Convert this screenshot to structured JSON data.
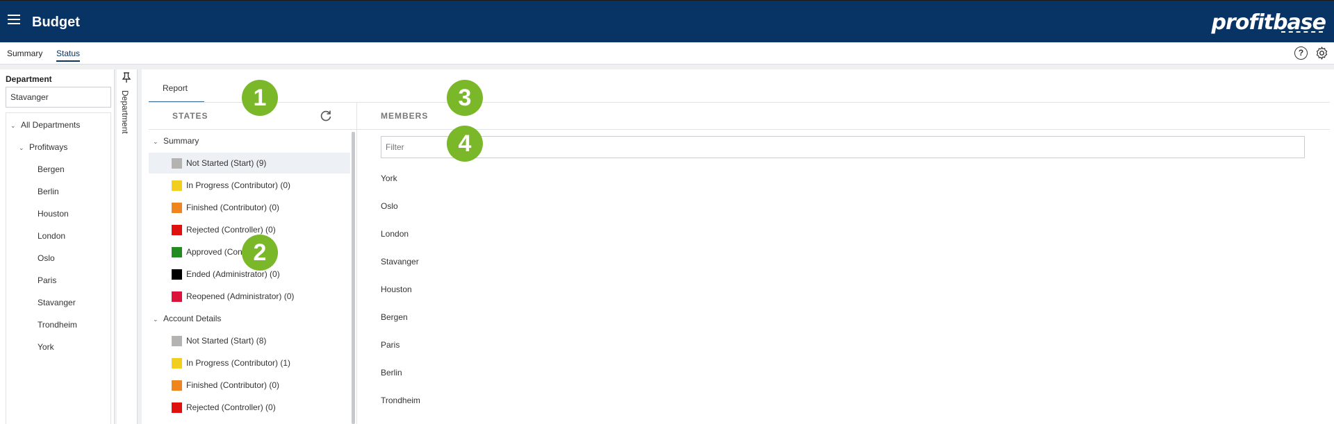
{
  "header": {
    "app_title": "Budget",
    "logo_text": "profitbase",
    "bg_color": "#073365"
  },
  "tabs": [
    {
      "label": "Summary",
      "active": false
    },
    {
      "label": "Status",
      "active": true
    }
  ],
  "toolbar_icons": {
    "help": "question-circle-icon",
    "settings": "gear-icon"
  },
  "department": {
    "label": "Department",
    "value": "Stavanger",
    "tree": [
      {
        "label": "All Departments",
        "level": 0,
        "expanded": true
      },
      {
        "label": "Profitways",
        "level": 1,
        "expanded": true
      },
      {
        "label": "Bergen",
        "level": 2
      },
      {
        "label": "Berlin",
        "level": 2
      },
      {
        "label": "Houston",
        "level": 2
      },
      {
        "label": "London",
        "level": 2
      },
      {
        "label": "Oslo",
        "level": 2
      },
      {
        "label": "Paris",
        "level": 2
      },
      {
        "label": "Stavanger",
        "level": 2
      },
      {
        "label": "Trondheim",
        "level": 2
      },
      {
        "label": "York",
        "level": 2
      }
    ]
  },
  "side_strip": {
    "label": "Department",
    "pin_icon": "pin-icon"
  },
  "report_tab": "Report",
  "states": {
    "header": "STATES",
    "groups": [
      {
        "label": "Summary",
        "items": [
          {
            "label": "Not Started (Start) (9)",
            "color": "#b5b2b2",
            "selected": true
          },
          {
            "label": "In Progress (Contributor) (0)",
            "color": "#f2cf1f"
          },
          {
            "label": "Finished (Contributor) (0)",
            "color": "#f0841f"
          },
          {
            "label": "Rejected (Controller) (0)",
            "color": "#e01010"
          },
          {
            "label": "Approved (Controller) (0)",
            "color": "#228b22"
          },
          {
            "label": "Ended (Administrator) (0)",
            "color": "#000000"
          },
          {
            "label": "Reopened (Administrator) (0)",
            "color": "#dc143c"
          }
        ]
      },
      {
        "label": "Account Details",
        "items": [
          {
            "label": "Not Started (Start) (8)",
            "color": "#b5b2b2"
          },
          {
            "label": "In Progress (Contributor) (1)",
            "color": "#f2cf1f"
          },
          {
            "label": "Finished (Contributor) (0)",
            "color": "#f0841f"
          },
          {
            "label": "Rejected (Controller) (0)",
            "color": "#e01010"
          }
        ]
      }
    ]
  },
  "members": {
    "header": "MEMBERS",
    "filter_placeholder": "Filter",
    "list": [
      "York",
      "Oslo",
      "London",
      "Stavanger",
      "Houston",
      "Bergen",
      "Paris",
      "Berlin",
      "Trondheim"
    ]
  },
  "callouts": [
    "1",
    "2",
    "3",
    "4"
  ],
  "callout_color": "#7ab82a"
}
